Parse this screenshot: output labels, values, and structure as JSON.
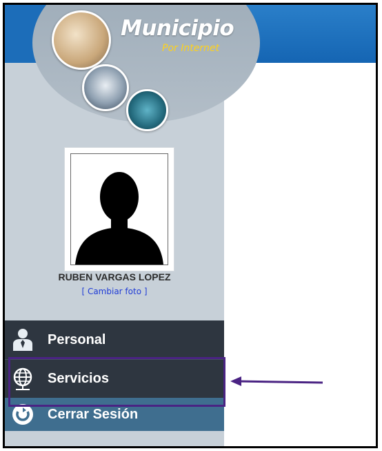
{
  "header": {
    "brand_title": "Municipio",
    "brand_subtitle": "Por Internet"
  },
  "profile": {
    "name": "RUBEN VARGAS LOPEZ",
    "change_photo_link": "[ Cambiar foto ]"
  },
  "menu": {
    "items": [
      {
        "label": "Personal",
        "icon": "users-icon"
      },
      {
        "label": "Servicios",
        "icon": "globe-icon"
      },
      {
        "label": "Cerrar Sesión",
        "icon": "power-icon"
      }
    ]
  },
  "annotation": {
    "highlight_color": "#4a2383",
    "arrow_color": "#4a2383"
  },
  "colors": {
    "header_blue": "#1c6db9",
    "sidebar": "#c7d0d8",
    "menu_dark": "#2e3640",
    "menu_logout": "#3f6e8f",
    "brand_yellow": "#ffd21a",
    "link_blue": "#1f3bd6"
  }
}
